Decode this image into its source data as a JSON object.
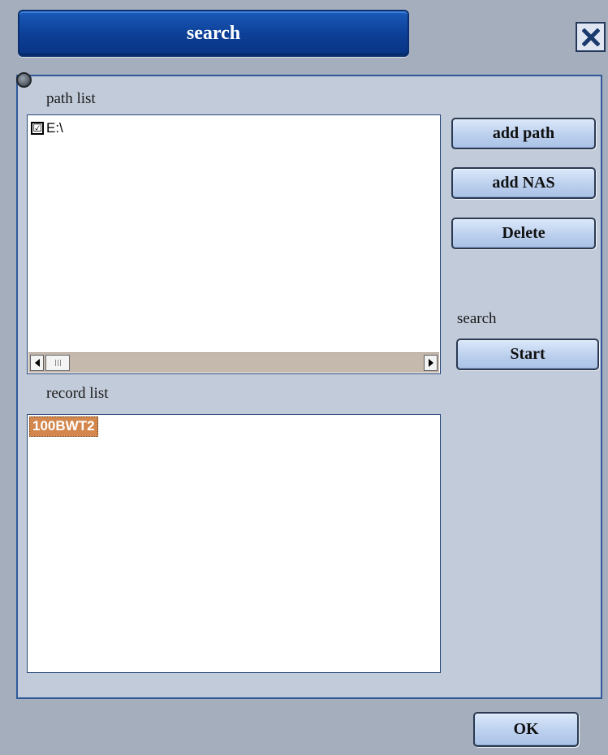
{
  "dialog": {
    "title": "search"
  },
  "title_bar": {
    "close_icon": "close-x-icon"
  },
  "path_panel": {
    "label": "path list",
    "items": [
      {
        "checked": true,
        "check_glyph": "☑",
        "path": "E:\\"
      }
    ]
  },
  "buttons": {
    "add_path": "add path",
    "add_nas": "add NAS",
    "delete": "Delete",
    "ok": "OK"
  },
  "search_panel": {
    "label": "search",
    "start_label": "Start"
  },
  "record_panel": {
    "label": "record list",
    "items": [
      {
        "name": "100BWT2",
        "selected": true
      }
    ]
  },
  "colors": {
    "title_bar": "#0c3f96",
    "panel_bg": "#c2cbd9",
    "panel_border": "#31599a",
    "selection": "#d3874c",
    "button_face": "#bcd0ee"
  }
}
